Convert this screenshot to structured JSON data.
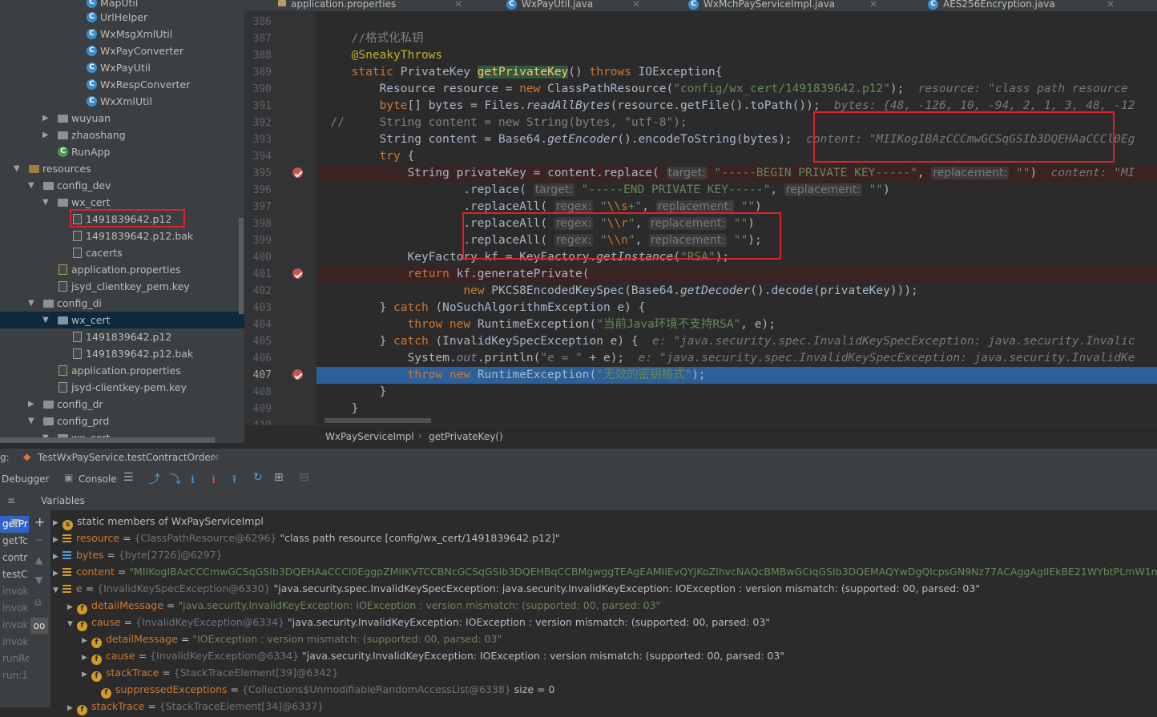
{
  "tree": {
    "rows": [
      {
        "label": "MapUtil",
        "icon": "class-icon"
      },
      {
        "label": "UrlHelper",
        "icon": "class-icon"
      },
      {
        "label": "WxMsgXmlUtil",
        "icon": "class-icon"
      },
      {
        "label": "WxPayConverter",
        "icon": "class-icon"
      },
      {
        "label": "WxPayUtil",
        "icon": "class-icon"
      },
      {
        "label": "WxRespConverter",
        "icon": "class-icon"
      },
      {
        "label": "WxXmlUtil",
        "icon": "class-icon"
      },
      {
        "label": "wuyuan",
        "icon": "folder-icon"
      },
      {
        "label": "zhaoshang",
        "icon": "folder-icon"
      },
      {
        "label": "RunApp",
        "icon": "run-class-icon"
      },
      {
        "label": "resources",
        "icon": "folder-icon"
      },
      {
        "label": "config_dev",
        "icon": "folder-icon"
      },
      {
        "label": "wx_cert",
        "icon": "folder-icon"
      },
      {
        "label": "1491839642.p12",
        "icon": "file-icon"
      },
      {
        "label": "1491839642.p12.bak",
        "icon": "file-icon"
      },
      {
        "label": "cacerts",
        "icon": "file-icon"
      },
      {
        "label": "application.properties",
        "icon": "properties-icon"
      },
      {
        "label": "jsyd_clientkey_pem.key",
        "icon": "file-icon"
      },
      {
        "label": "config_di",
        "icon": "folder-icon"
      },
      {
        "label": "wx_cert",
        "icon": "folder-icon"
      },
      {
        "label": "1491839642.p12",
        "icon": "file-icon"
      },
      {
        "label": "1491839642.p12.bak",
        "icon": "file-icon"
      },
      {
        "label": "application.properties",
        "icon": "properties-icon"
      },
      {
        "label": "jsyd-clientkey-pem.key",
        "icon": "file-icon"
      },
      {
        "label": "config_dr",
        "icon": "folder-icon"
      },
      {
        "label": "config_prd",
        "icon": "folder-icon"
      },
      {
        "label": "wx_cert",
        "icon": "folder-icon"
      }
    ]
  },
  "editor": {
    "tabs": [
      "application.properties",
      "WxPayUtil.java",
      "WxMchPayServiceImpl.java",
      "AES256Encryption.java"
    ],
    "line_numbers": [
      "386",
      "387",
      "388",
      "389",
      "390",
      "391",
      "392",
      "393",
      "394",
      "395",
      "396",
      "397",
      "398",
      "399",
      "400",
      "401",
      "402",
      "403",
      "404",
      "405",
      "406",
      "407",
      "408",
      "409",
      "410"
    ],
    "breakpoint_lines": [
      "395",
      "401",
      "407"
    ],
    "current_line": "407",
    "breadcrumb": [
      "WxPayServiceImpl",
      "getPrivateKey()"
    ],
    "code": {
      "l387_comment": "//格式化私钥",
      "l388_annotation": "@SneakyThrows",
      "l389_kw_static": "static ",
      "l389_type": "PrivateKey ",
      "l389_method": "getPrivateKey",
      "l389_rest": "() ",
      "l389_throws": "throws ",
      "l389_ex": "IOException{",
      "l390_a": "Resource resource = ",
      "l390_new": "new ",
      "l390_b": "ClassPathResource(",
      "l390_str": "\"config/wx_cert/1491839642.p12\"",
      "l390_c": ");",
      "l390_inline": "resource: \"class path resource",
      "l391_kw": "byte",
      "l391_a": "[] bytes = Files.",
      "l391_m": "readAllBytes",
      "l391_b": "(resource.getFile().toPath());",
      "l391_inline": "bytes: {48, -126, 10, -94, 2, 1, 3, 48, -12",
      "l392_text": "//     String content = new String(bytes, \"utf-8\");",
      "l393_a": "String content = Base64.",
      "l393_m": "getEncoder",
      "l393_b": "().encodeToString(bytes);",
      "l393_inline": "content: \"MIIKogIBAzCCCmwGCSqGSIb3DQEHAaCCCl0Eg",
      "l394_kw": "try",
      "l394_b": " {",
      "l395_a": "String privateKey = content.replace(",
      "l395_h1": "target:",
      "l395_s1": "\"-----BEGIN PRIVATE KEY-----\"",
      "l395_h2": "replacement:",
      "l395_s2": "\"\"",
      "l395_c": ")",
      "l395_inline": "content: \"MI",
      "l396_a": ".replace(",
      "l396_h1": "target:",
      "l396_s1": "\"-----END PRIVATE KEY-----\"",
      "l396_h2": "replacement:",
      "l396_s2": "\"\"",
      "l396_c": ")",
      "l397_a": ".replaceAll(",
      "l397_h1": "regex:",
      "l397_s1a": "\"",
      "l397_s1b": "\\\\s",
      "l397_s1c": "+\"",
      "l397_h2": "replacement:",
      "l397_s2": "\"\"",
      "l397_c": ")",
      "l398_a": ".replaceAll(",
      "l398_h1": "regex:",
      "l398_s1a": "\"",
      "l398_s1b": "\\\\r",
      "l398_s1c": "\"",
      "l398_h2": "replacement:",
      "l398_s2": "\"\"",
      "l398_c": ")",
      "l399_a": ".replaceAll(",
      "l399_h1": "regex:",
      "l399_s1a": "\"",
      "l399_s1b": "\\\\n",
      "l399_s1c": "\"",
      "l399_h2": "replacement:",
      "l399_s2": "\"\"",
      "l399_c": ");",
      "l400_a": "KeyFactory kf = KeyFactory.",
      "l400_m": "getInstance",
      "l400_b": "(",
      "l400_s": "\"RSA\"",
      "l400_c": ");",
      "l401_kw": "return ",
      "l401_b": "kf.generatePrivate(",
      "l402_new": "new ",
      "l402_a": "PKCS8EncodedKeySpec(Base64.",
      "l402_m": "getDecoder",
      "l402_b": "().decode(privateKey)));",
      "l403_a": "} ",
      "l403_kw": "catch ",
      "l403_b": "(NoSuchAlgorithmException e) {",
      "l404_kw": "throw new ",
      "l404_a": "RuntimeException(",
      "l404_s": "\"当前Java环境不支持RSA\"",
      "l404_b": ", e);",
      "l405_a": "} ",
      "l405_kw": "catch ",
      "l405_b": "(InvalidKeySpecException e) {",
      "l405_inline": "e: \"java.security.spec.InvalidKeySpecException: java.security.Invalic",
      "l406_a": "System.",
      "l406_f": "out",
      "l406_b": ".println(",
      "l406_s": "\"e = \"",
      "l406_c": " + e);",
      "l406_inline": "e: \"java.security.spec.InvalidKeySpecException: java.security.InvalidKe",
      "l407_kw": "throw new ",
      "l407_a": "RuntimeException(",
      "l407_s": "\"无效的密钥格式\"",
      "l407_b": ");",
      "l408": "}",
      "l409": "}"
    }
  },
  "debug": {
    "title_prefix": "g:",
    "session_tab": "TestWxPayService.testContractOrder",
    "debugger_tab": "Debugger",
    "console_tab": "Console",
    "variables_label": "Variables",
    "frames": [
      "getPr",
      "getTc",
      "contr",
      "testC",
      "invok",
      "invok",
      "invok",
      "invok",
      "runRe",
      "run:1"
    ],
    "vars": [
      {
        "name": "static members of WxPayServiceImpl",
        "eq": "",
        "ref": "",
        "val": ""
      },
      {
        "name": "resource",
        "eq": " = ",
        "ref": "{ClassPathResource@6296} ",
        "val": "\"class path resource [config/wx_cert/1491839642.p12]\""
      },
      {
        "name": "bytes",
        "eq": " = ",
        "ref": "{byte[2726]@6297}",
        "val": ""
      },
      {
        "name": "content",
        "eq": " = ",
        "ref": "",
        "val": "\"MIIKogIBAzCCCmwGCSqGSIb3DQEHAaCCCl0EggpZMIIKVTCCBNcGCSqGSIb3DQEHBqCCBMgwggTEAgEAMIIEvQYJKoZIhvcNAQcBMBwGCiqGSIb3DQEMAQYwDgQIcpsGN9Nz77ACAggAgIIEkBE21WYbtPLmW1mZHyCZNE"
      },
      {
        "name": "e",
        "eq": " = ",
        "ref": "{InvalidKeySpecException@6330} ",
        "val": "\"java.security.spec.InvalidKeySpecException: java.security.InvalidKeyException: IOException : version mismatch: (supported:     00, parsed:     03\""
      },
      {
        "name": "detailMessage",
        "eq": " = ",
        "ref": "",
        "val": "\"java.security.InvalidKeyException: IOException : version mismatch: (supported:     00, parsed:     03\""
      },
      {
        "name": "cause",
        "eq": " = ",
        "ref": "{InvalidKeyException@6334} ",
        "val": "\"java.security.InvalidKeyException: IOException : version mismatch: (supported:     00, parsed:     03\""
      },
      {
        "name": "detailMessage",
        "eq": " = ",
        "ref": "",
        "val": "\"IOException : version mismatch: (supported:     00, parsed:     03\""
      },
      {
        "name": "cause",
        "eq": " = ",
        "ref": "{InvalidKeyException@6334} ",
        "val": "\"java.security.InvalidKeyException: IOException : version mismatch: (supported:     00, parsed:     03\""
      },
      {
        "name": "stackTrace",
        "eq": " = ",
        "ref": "{StackTraceElement[39]@6342}",
        "val": ""
      },
      {
        "name": "suppressedExceptions",
        "eq": " = ",
        "ref": "{Collections$UnmodifiableRandomAccessList@6338} ",
        "val": " size = 0"
      },
      {
        "name": "stackTrace",
        "eq": " = ",
        "ref": "{StackTraceElement[34]@6337}",
        "val": ""
      }
    ]
  }
}
